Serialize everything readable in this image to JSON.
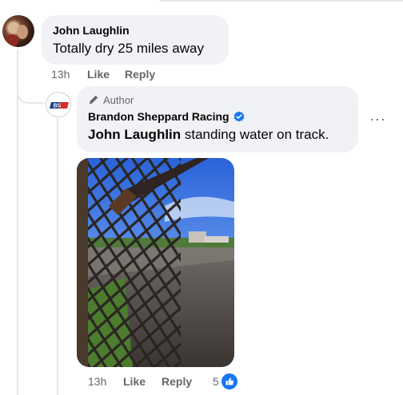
{
  "comment": {
    "author": "John Laughlin",
    "text": "Totally dry 25 miles away",
    "time": "13h",
    "like_label": "Like",
    "reply_label": "Reply"
  },
  "reply": {
    "badge": "Author",
    "author": "Brandon Sheppard Racing",
    "mention": "John Laughlin",
    "text": " standing water on track.",
    "time": "13h",
    "like_label": "Like",
    "reply_label": "Reply",
    "reaction_count": "5",
    "more_label": "···",
    "verified_color": "#1877f2"
  },
  "icons": {
    "badge": "pencil-icon",
    "verified": "verified-check-icon",
    "reaction": "thumbs-up-icon",
    "more": "more-horizontal-icon"
  }
}
